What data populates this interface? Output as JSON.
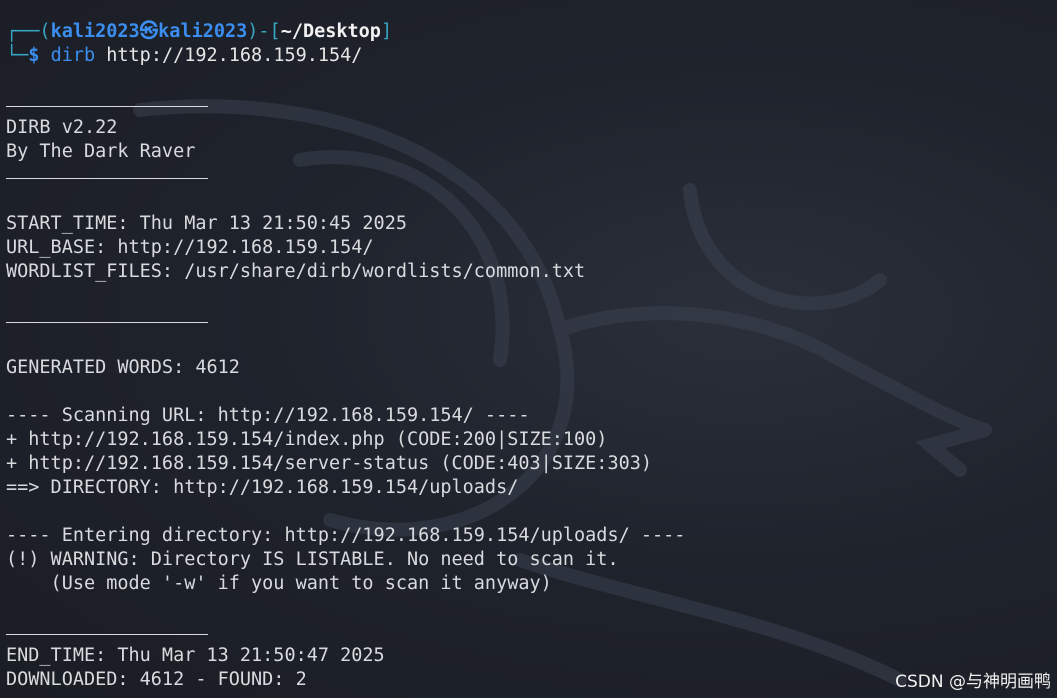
{
  "prompt": {
    "user_host": "kali2023㉿kali2023",
    "cwd": "~/Desktop",
    "command": "dirb",
    "argument": "http://192.168.159.154/"
  },
  "output": {
    "banner_version": "DIRB v2.22",
    "banner_author": "By The Dark Raver",
    "start_time": "START_TIME: Thu Mar 13 21:50:45 2025",
    "url_base": "URL_BASE: http://192.168.159.154/",
    "wordlist_files": "WORDLIST_FILES: /usr/share/dirb/wordlists/common.txt",
    "generated_words": "GENERATED WORDS: 4612",
    "scan_header": "---- Scanning URL: http://192.168.159.154/ ----",
    "results": [
      "+ http://192.168.159.154/index.php (CODE:200|SIZE:100)",
      "+ http://192.168.159.154/server-status (CODE:403|SIZE:303)",
      "==> DIRECTORY: http://192.168.159.154/uploads/"
    ],
    "enter_header": "---- Entering directory: http://192.168.159.154/uploads/ ----",
    "warning": "(!) WARNING: Directory IS LISTABLE. No need to scan it.",
    "warning_hint": "    (Use mode '-w' if you want to scan it anyway)",
    "end_time": "END_TIME: Thu Mar 13 21:50:47 2025",
    "downloaded": "DOWNLOADED: 4612 - FOUND: 2"
  },
  "watermark": "CSDN @与神明画鸭",
  "colors": {
    "background": "#1f232c",
    "prompt_blue": "#3b8ef0",
    "text": "#d8dade",
    "frame_cyan": "#37a6c4"
  }
}
